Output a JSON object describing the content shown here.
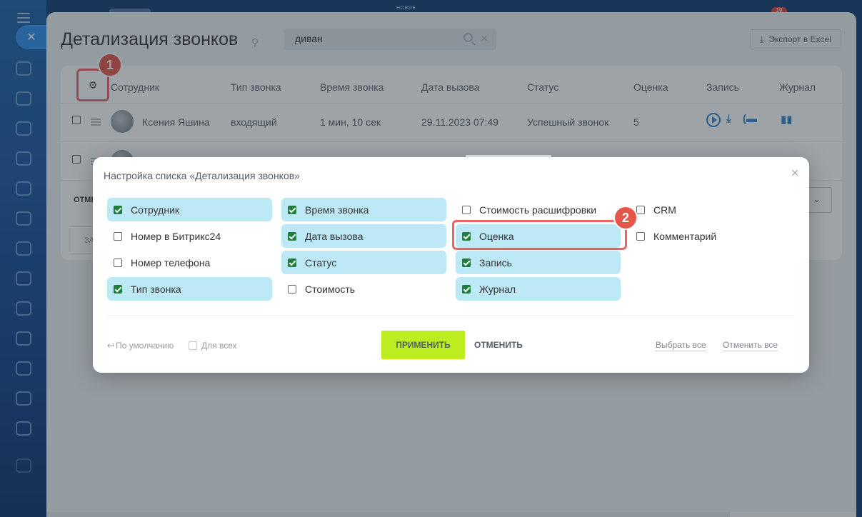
{
  "topbar": {
    "new_label": "НОВОЕ",
    "counter": "19"
  },
  "page": {
    "title": "Детализация звонков",
    "search_value": "диван",
    "export_label": "Экспорт в Excel"
  },
  "grid": {
    "columns": [
      "Сотрудник",
      "Тип звонка",
      "Время звонка",
      "Дата вызова",
      "Статус",
      "Оценка",
      "Запись",
      "Журнал"
    ],
    "row1": {
      "employee": "Ксения Яшина",
      "call_type": "входящий",
      "duration": "1 мин, 10 сек",
      "date": "29.11.2023 07:49",
      "status": "Успешный звонок",
      "rating": "5"
    },
    "footer_partial_1": "ОТМЕ",
    "footer_partial_2": "ЗА"
  },
  "annotations": {
    "badge1": "1",
    "badge2": "2"
  },
  "modal": {
    "title": "Настройка списка «Детализация звонков»",
    "options": [
      {
        "label": "Сотрудник",
        "checked": true
      },
      {
        "label": "Номер в Битрикс24",
        "checked": false
      },
      {
        "label": "Номер телефона",
        "checked": false
      },
      {
        "label": "Тип звонка",
        "checked": true
      },
      {
        "label": "Время звонка",
        "checked": true
      },
      {
        "label": "Дата вызова",
        "checked": true
      },
      {
        "label": "Статус",
        "checked": true
      },
      {
        "label": "Стоимость",
        "checked": false
      },
      {
        "label": "Стоимость расшифровки",
        "checked": false
      },
      {
        "label": "Оценка",
        "checked": true
      },
      {
        "label": "Запись",
        "checked": true
      },
      {
        "label": "Журнал",
        "checked": true
      },
      {
        "label": "CRM",
        "checked": false
      },
      {
        "label": "Комментарий",
        "checked": false
      }
    ],
    "default_label": "По умолчанию",
    "for_all_label": "Для всех",
    "apply_label": "ПРИМЕНИТЬ",
    "cancel_label": "ОТМЕНИТЬ",
    "select_all_label": "Выбрать все",
    "deselect_all_label": "Отменить все"
  },
  "colors": {
    "accent_check": "#1e7e3c",
    "apply_bg": "#bbed21",
    "highlight": "#ee6161",
    "selected_bg": "#bde9f7"
  }
}
